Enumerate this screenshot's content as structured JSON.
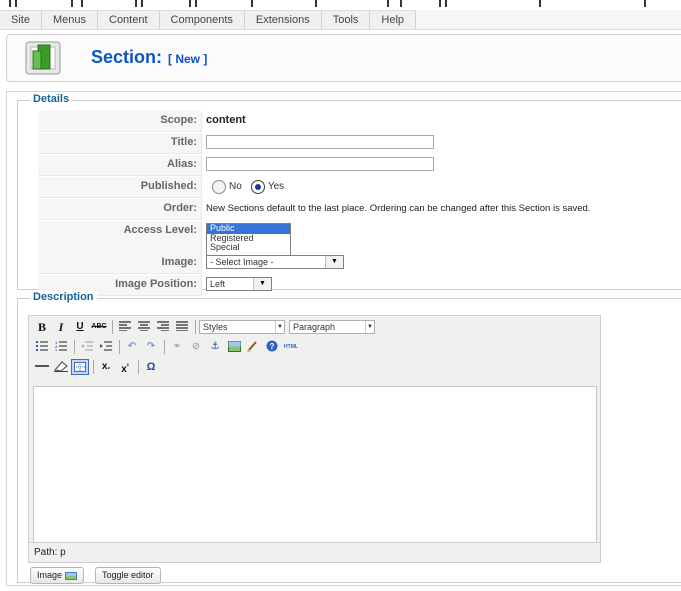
{
  "menu": {
    "items": [
      "Site",
      "Menus",
      "Content",
      "Components",
      "Extensions",
      "Tools",
      "Help"
    ]
  },
  "header": {
    "title": "Section:",
    "subtitle": "[ New ]"
  },
  "details": {
    "legend": "Details",
    "scope_label": "Scope:",
    "scope_value": "content",
    "title_label": "Title:",
    "title_value": "",
    "alias_label": "Alias:",
    "alias_value": "",
    "published_label": "Published:",
    "published_no": "No",
    "published_yes": "Yes",
    "published_selected": "Yes",
    "order_label": "Order:",
    "order_text": "New Sections default to the last place. Ordering can be changed after this Section is saved.",
    "access_label": "Access Level:",
    "access_options": [
      "Public",
      "Registered",
      "Special"
    ],
    "access_selected": "Public",
    "image_label": "Image:",
    "image_value": "- Select Image -",
    "image_position_label": "Image Position:",
    "image_position_value": "Left"
  },
  "description": {
    "legend": "Description",
    "styles_value": "Styles",
    "format_value": "Paragraph",
    "path_text": "Path: p"
  },
  "buttons": {
    "image_label": "Image",
    "toggle_label": "Toggle editor"
  },
  "colors": {
    "accent": "#0b55c4",
    "legend": "#146295",
    "selected_option": "#3874d8"
  }
}
